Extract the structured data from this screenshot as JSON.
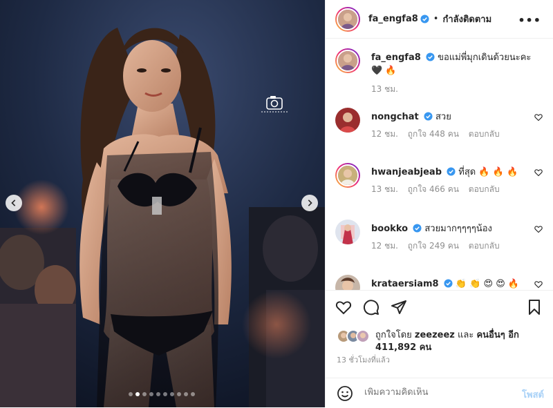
{
  "post": {
    "username": "fa_engfa8",
    "separator": "•",
    "follow_status": "กำลังติดตาม",
    "caption": "ขอแม่พี่มุกเดินด้วยนะคะ 🖤 🔥",
    "caption_time": "13 ชม."
  },
  "comments": [
    {
      "username": "nongchat",
      "text": "สวย",
      "time": "12 ชม.",
      "likes": "ถูกใจ 448 คน",
      "reply": "ตอบกลับ"
    },
    {
      "username": "hwanjeabjeab",
      "text": "ที่สุด 🔥 🔥 🔥",
      "time": "13 ชม.",
      "likes": "ถูกใจ 466 คน",
      "reply": "ตอบกลับ"
    },
    {
      "username": "bookko",
      "text": "สวยมากๆๆๆๆน้อง",
      "time": "12 ชม.",
      "likes": "ถูกใจ 249 คน",
      "reply": "ตอบกลับ"
    },
    {
      "username": "krataersiam8",
      "text": "👏 👏 😍 😍 🔥",
      "time": "",
      "likes": "",
      "reply": ""
    }
  ],
  "likes": {
    "prefix": "ถูกใจโดย",
    "user": "zeezeez",
    "joiner": "และ",
    "others": "คนอื่นๆ อีก 411,892 คน"
  },
  "posted_ago": "13 ชั่วโมงที่แล้ว",
  "comment_box": {
    "placeholder": "เพิ่มความคิดเห็น",
    "post_label": "โพสต์"
  },
  "carousel": {
    "total": 10,
    "active_index": 1
  },
  "icons": [
    "verified-badge",
    "more-icon",
    "heart-icon",
    "comment-icon",
    "share-icon",
    "bookmark-icon",
    "emoji-icon",
    "chevron-left-icon",
    "chevron-right-icon",
    "camera-watermark-icon"
  ],
  "colors": {
    "verified": "#3897f0",
    "post_button_disabled": "#a8d1f7",
    "muted_text": "#8e8e8e"
  }
}
